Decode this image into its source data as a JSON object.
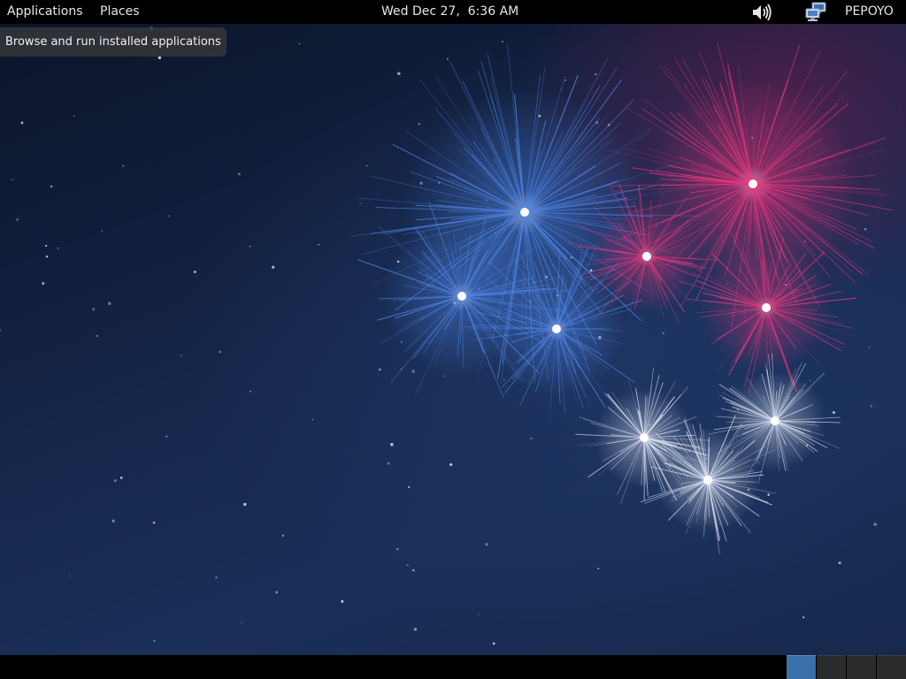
{
  "top_panel": {
    "applications_label": "Applications",
    "places_label": "Places",
    "clock": "Wed Dec 27,  6:36 AM",
    "volume_icon": "speaker-volume-icon",
    "network_icon": "network-computers-icon",
    "user_name": "PEPOYO"
  },
  "tooltip": {
    "text": "Browse and run installed applications"
  },
  "wallpaper": {
    "description_icon": "fireworks-wallpaper",
    "colors": {
      "sky_dark": "#0b1326",
      "sky_mid": "#1a2f58",
      "firework_blue": "#4f86e8",
      "firework_pink": "#e8377f",
      "firework_white": "#dfe6f5"
    }
  },
  "bottom_panel": {
    "workspaces": [
      {
        "active": true
      },
      {
        "active": false
      },
      {
        "active": false
      },
      {
        "active": false
      }
    ],
    "colors": {
      "active_workspace": "#3a6fa8",
      "inactive_workspace": "#2a2b2d"
    }
  }
}
